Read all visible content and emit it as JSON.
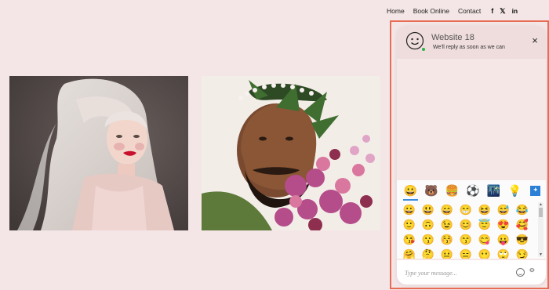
{
  "nav": {
    "links": [
      "Home",
      "Book Online",
      "Contact"
    ],
    "social": [
      "facebook-icon",
      "twitter-icon",
      "linkedin-icon"
    ],
    "social_glyphs": [
      "f",
      "𝕏",
      "in"
    ]
  },
  "chat": {
    "title": "Website 18",
    "subtitle": "We'll reply as soon as we can",
    "close": "×",
    "input_placeholder": "Type your message...",
    "status_color": "#2bb24c",
    "accent_color": "#e86d55",
    "emoji_categories": [
      "😀",
      "🐻",
      "🍔",
      "⚽",
      "🌃",
      "💡",
      "🔣"
    ],
    "emoji_category_names": [
      "smileys",
      "animals",
      "food",
      "activities",
      "travel",
      "objects",
      "symbols"
    ],
    "emojis": [
      "😀",
      "😃",
      "😄",
      "😁",
      "😆",
      "😅",
      "😂",
      "🙂",
      "🙃",
      "😉",
      "😊",
      "😇",
      "😍",
      "🥰",
      "😘",
      "😗",
      "😚",
      "😙",
      "😋",
      "😛",
      "😎",
      "🤗",
      "🤔",
      "😐",
      "😑",
      "😶",
      "🙄",
      "😏"
    ]
  }
}
